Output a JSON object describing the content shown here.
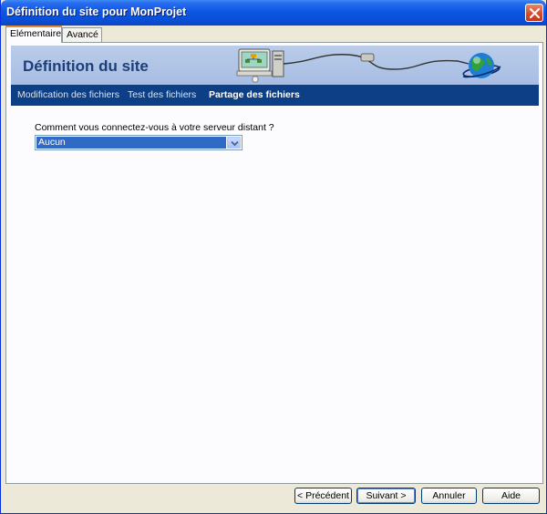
{
  "window": {
    "title": "Définition du site pour MonProjet"
  },
  "tabs": [
    {
      "label": "Elémentaire",
      "active": true
    },
    {
      "label": "Avancé",
      "active": false
    }
  ],
  "banner": {
    "heading": "Définition du site"
  },
  "steps": [
    {
      "label": "Modification des fichiers"
    },
    {
      "label": "Test des fichiers"
    },
    {
      "label": "Partage des fichiers",
      "current": true
    }
  ],
  "form": {
    "question": "Comment vous connectez-vous à votre serveur distant ?",
    "connection": {
      "selected": "Aucun"
    }
  },
  "buttons": {
    "previous": "< Précédent",
    "next": "Suivant >",
    "cancel": "Annuler",
    "help": "Aide"
  },
  "colors": {
    "titlebar": "#0a4fd6",
    "banner": "#a7bde3",
    "navbar": "#0c3f86",
    "selection": "#316ac5"
  },
  "icons": [
    "close-icon",
    "computer-icon",
    "globe-icon",
    "dropdown-arrow-icon"
  ]
}
